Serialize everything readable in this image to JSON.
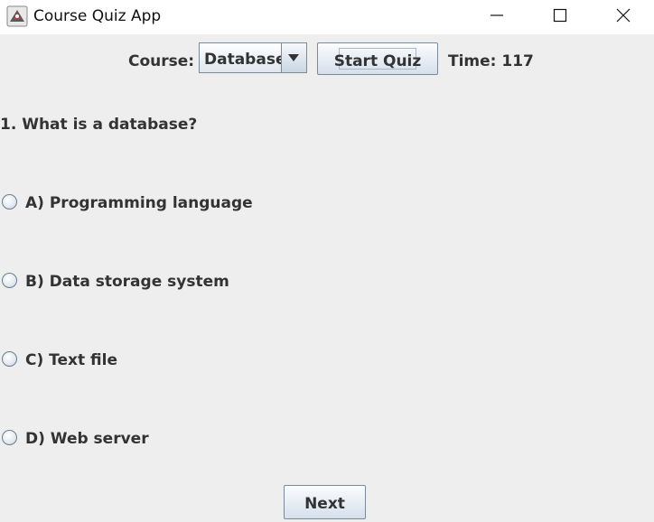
{
  "window": {
    "title": "Course Quiz App",
    "icon": "java-app-icon",
    "controls": [
      "minimize-icon",
      "maximize-icon",
      "close-icon"
    ]
  },
  "toolbar": {
    "course_label": "Course:",
    "course_selected": "Database",
    "start_label": "Start Quiz",
    "timer_text": "Time: 117"
  },
  "quiz": {
    "question": "1. What is a database?",
    "options": [
      {
        "label": "A) Programming language",
        "selected": false
      },
      {
        "label": "B) Data storage system",
        "selected": false
      },
      {
        "label": "C) Text file",
        "selected": false
      },
      {
        "label": "D) Web server",
        "selected": false
      }
    ],
    "next_label": "Next"
  },
  "colors": {
    "background": "#eeeeee",
    "text": "#333333",
    "button_border": "#7a8a99"
  }
}
